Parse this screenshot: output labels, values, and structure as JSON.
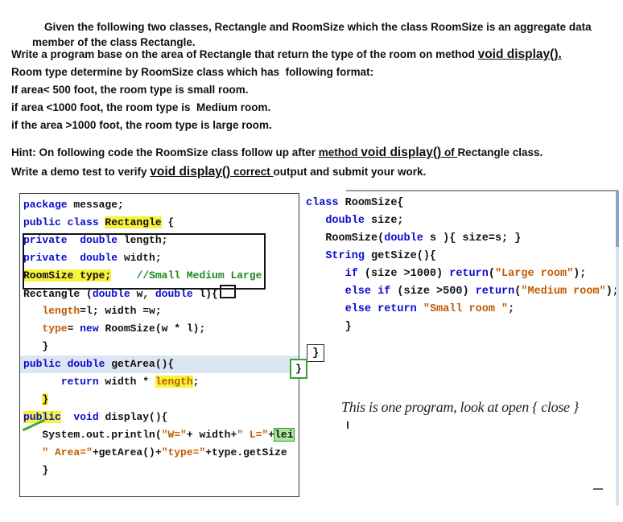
{
  "colors": {
    "kw": "#0a0ad0",
    "str": "#c05a00",
    "cm": "#1e8a1e",
    "hl_y": "#f7f23c",
    "hl_g": "#a9e79d",
    "sel": "#dce6f3"
  },
  "intro": {
    "p1": "Given the following two classes, Rectangle and RoomSize which the class RoomSize is an aggregate data member of the class Rectangle."
  },
  "task": {
    "line1_pre": "Write a program base on the area of Rectangle that return the type of the room on method ",
    "line1_u": "void display().",
    "line2": "Room type determine by RoomSize class which has  following format:",
    "line3": "If area< 500 foot, the room type is small room.",
    "line4": "if area <1000 foot, the room type is  Medium room.",
    "line5": "if the area >1000 foot, the room type is large room."
  },
  "hint": {
    "line1_pre": "Hint: On following code the RoomSize class follow up after ",
    "line1_u1": "method ",
    "line1_u2": "void display()",
    "line1_u3": " of ",
    "line1_post": "Rectangle class.",
    "line2_pre": "Write a demo test to verify ",
    "line2_u": "void display()",
    "line2_u2": " correct ",
    "line2_post": "output and submit your work."
  },
  "rectangle_code": {
    "lines": [
      {
        "tk": [
          {
            "x": "package",
            "c": "k"
          },
          {
            "x": " message;",
            "c": "p"
          }
        ]
      },
      {
        "tk": [
          {
            "x": "public class ",
            "c": "k"
          },
          {
            "x": "Rectangle",
            "c": "p",
            "b": "y"
          },
          {
            "x": " {",
            "c": "p"
          }
        ]
      },
      {
        "tk": [
          {
            "x": "private",
            "c": "k"
          },
          {
            "x": "  ",
            "c": "p"
          },
          {
            "x": "double",
            "c": "k"
          },
          {
            "x": " length;",
            "c": "p"
          }
        ]
      },
      {
        "tk": [
          {
            "x": "private",
            "c": "k"
          },
          {
            "x": "  ",
            "c": "p"
          },
          {
            "x": "double",
            "c": "k"
          },
          {
            "x": " width;",
            "c": "p"
          }
        ]
      },
      {
        "tk": [
          {
            "x": "RoomSize type;",
            "c": "p",
            "b": "y"
          },
          {
            "x": "    ",
            "c": "p"
          },
          {
            "x": "//Small Medium Large",
            "c": "c"
          }
        ]
      },
      {
        "tk": [
          {
            "x": "Rectangle (",
            "c": "p"
          },
          {
            "x": "double",
            "c": "k"
          },
          {
            "x": " w, ",
            "c": "p"
          },
          {
            "x": "double",
            "c": "k"
          },
          {
            "x": " l)",
            "c": "p"
          },
          {
            "x": "{",
            "c": "p"
          }
        ],
        "box": true
      },
      {
        "tk": [
          {
            "x": "   ",
            "c": "p"
          },
          {
            "x": "length",
            "c": "v"
          },
          {
            "x": "=l; width =w;",
            "c": "p"
          }
        ]
      },
      {
        "tk": [
          {
            "x": "   ",
            "c": "p"
          },
          {
            "x": "type",
            "c": "v"
          },
          {
            "x": "= ",
            "c": "p"
          },
          {
            "x": "new",
            "c": "k"
          },
          {
            "x": " RoomSize(w * l);",
            "c": "p"
          }
        ]
      },
      {
        "tk": [
          {
            "x": "   }",
            "c": "p"
          }
        ]
      },
      {
        "tk": [
          {
            "x": "public",
            "c": "k"
          },
          {
            "x": " ",
            "c": "p"
          },
          {
            "x": "double",
            "c": "k"
          },
          {
            "x": " getArea(){",
            "c": "p"
          }
        ],
        "sel": true
      },
      {
        "tk": [
          {
            "x": "      ",
            "c": "p"
          },
          {
            "x": "return",
            "c": "k"
          },
          {
            "x": " width * ",
            "c": "p"
          },
          {
            "x": "length",
            "c": "v",
            "b": "y"
          },
          {
            "x": ";",
            "c": "p"
          }
        ]
      },
      {
        "tk": [
          {
            "x": "   ",
            "c": "p"
          },
          {
            "x": "}",
            "c": "p",
            "b": "y"
          }
        ]
      },
      {
        "tk": [
          {
            "x": "public",
            "c": "k",
            "b": "y"
          },
          {
            "x": "  ",
            "c": "p"
          },
          {
            "x": "void",
            "c": "k"
          },
          {
            "x": " display(){",
            "c": "p"
          }
        ]
      },
      {
        "tk": [
          {
            "x": "   ",
            "c": "p"
          },
          {
            "x": "System.out.println(",
            "c": "p"
          },
          {
            "x": "\"W=\"",
            "c": "s"
          },
          {
            "x": "+ width+",
            "c": "p"
          },
          {
            "x": "\" L=\"",
            "c": "s"
          },
          {
            "x": "+",
            "c": "p"
          },
          {
            "x": "lei",
            "c": "p",
            "b": "g"
          }
        ]
      },
      {
        "tk": [
          {
            "x": "   ",
            "c": "p"
          },
          {
            "x": "\" Area=\"",
            "c": "s"
          },
          {
            "x": "+getArea()+",
            "c": "p"
          },
          {
            "x": "\"type=\"",
            "c": "s"
          },
          {
            "x": "+type.getSize",
            "c": "p"
          }
        ]
      },
      {
        "tk": [
          {
            "x": "   }",
            "c": "p"
          }
        ]
      }
    ]
  },
  "roomsize_code": {
    "lines": [
      {
        "tk": [
          {
            "x": "class",
            "c": "k"
          },
          {
            "x": " RoomSize{",
            "c": "p"
          }
        ]
      },
      {
        "tk": [
          {
            "x": "   ",
            "c": "p"
          },
          {
            "x": "double",
            "c": "k"
          },
          {
            "x": " size;",
            "c": "p"
          }
        ]
      },
      {
        "tk": [
          {
            "x": "   RoomSize(",
            "c": "p"
          },
          {
            "x": "double",
            "c": "k"
          },
          {
            "x": " s ){ size=s; }",
            "c": "p"
          }
        ]
      },
      {
        "tk": [
          {
            "x": "   ",
            "c": "p"
          },
          {
            "x": "String",
            "c": "k"
          },
          {
            "x": " getSize(){",
            "c": "p"
          }
        ]
      },
      {
        "tk": [
          {
            "x": "      ",
            "c": "p"
          },
          {
            "x": "if",
            "c": "k"
          },
          {
            "x": " (size >1000) ",
            "c": "p"
          },
          {
            "x": "return",
            "c": "k"
          },
          {
            "x": "(",
            "c": "p"
          },
          {
            "x": "\"Large room\"",
            "c": "s"
          },
          {
            "x": ");",
            "c": "p"
          }
        ]
      },
      {
        "tk": [
          {
            "x": "      ",
            "c": "p"
          },
          {
            "x": "else",
            "c": "k"
          },
          {
            "x": " ",
            "c": "p"
          },
          {
            "x": "if",
            "c": "k"
          },
          {
            "x": " (size >500) ",
            "c": "p"
          },
          {
            "x": "return",
            "c": "k"
          },
          {
            "x": "(",
            "c": "p"
          },
          {
            "x": "\"Medium room\"",
            "c": "s"
          },
          {
            "x": ");",
            "c": "p"
          }
        ]
      },
      {
        "tk": [
          {
            "x": "      ",
            "c": "p"
          },
          {
            "x": "else",
            "c": "k"
          },
          {
            "x": " ",
            "c": "p"
          },
          {
            "x": "return",
            "c": "k"
          },
          {
            "x": " ",
            "c": "p"
          },
          {
            "x": "\"Small room \"",
            "c": "s"
          },
          {
            "x": ";",
            "c": "p"
          }
        ]
      },
      {
        "tk": [
          {
            "x": "      }",
            "c": "p"
          }
        ]
      }
    ]
  },
  "annotations": {
    "black_brace": "}",
    "green_brace": "}",
    "note": "This is one program, look at open { close }"
  }
}
